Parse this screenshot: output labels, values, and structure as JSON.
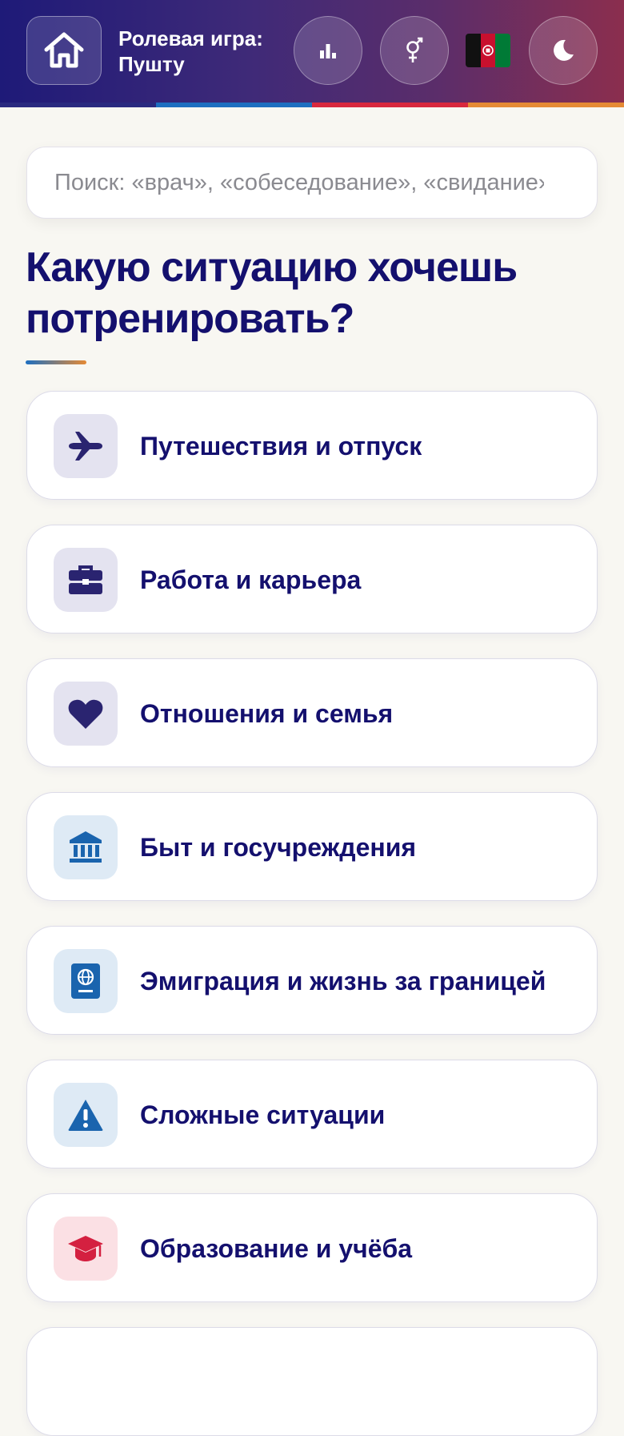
{
  "header": {
    "title_line1": "Ролевая игра:",
    "title_line2": "Пушту",
    "icons": [
      "home-icon",
      "stats-icon",
      "gender-icon",
      "flag-afghanistan",
      "moon-icon"
    ]
  },
  "search": {
    "placeholder": "Поиск: «врач», «собеседование», «свидание»…"
  },
  "question": "Какую ситуацию хочешь потренировать?",
  "categories": [
    {
      "label": "Путешествия и отпуск",
      "icon": "airplane-icon",
      "color": "#2a2470",
      "bg": "#e4e3f0"
    },
    {
      "label": "Работа и карьера",
      "icon": "briefcase-icon",
      "color": "#2a2470",
      "bg": "#e4e3f0"
    },
    {
      "label": "Отношения и семья",
      "icon": "heart-icon",
      "color": "#2a2470",
      "bg": "#e4e3f0"
    },
    {
      "label": "Быт и госучреждения",
      "icon": "bank-icon",
      "color": "#1a64ae",
      "bg": "#deeaf5"
    },
    {
      "label": "Эмиграция и жизнь за границей",
      "icon": "passport-icon",
      "color": "#1a64ae",
      "bg": "#deeaf5"
    },
    {
      "label": "Сложные ситуации",
      "icon": "warning-icon",
      "color": "#1a64ae",
      "bg": "#deeaf5"
    },
    {
      "label": "Образование и учёба",
      "icon": "graduation-cap-icon",
      "color": "#d42040",
      "bg": "#fbe0e4"
    }
  ],
  "colors": {
    "stripe": [
      "#2a2a80",
      "#1e6fc0",
      "#d8283e",
      "#e58a35"
    ],
    "flag": [
      "#111111",
      "#c8102e",
      "#007a36"
    ]
  }
}
